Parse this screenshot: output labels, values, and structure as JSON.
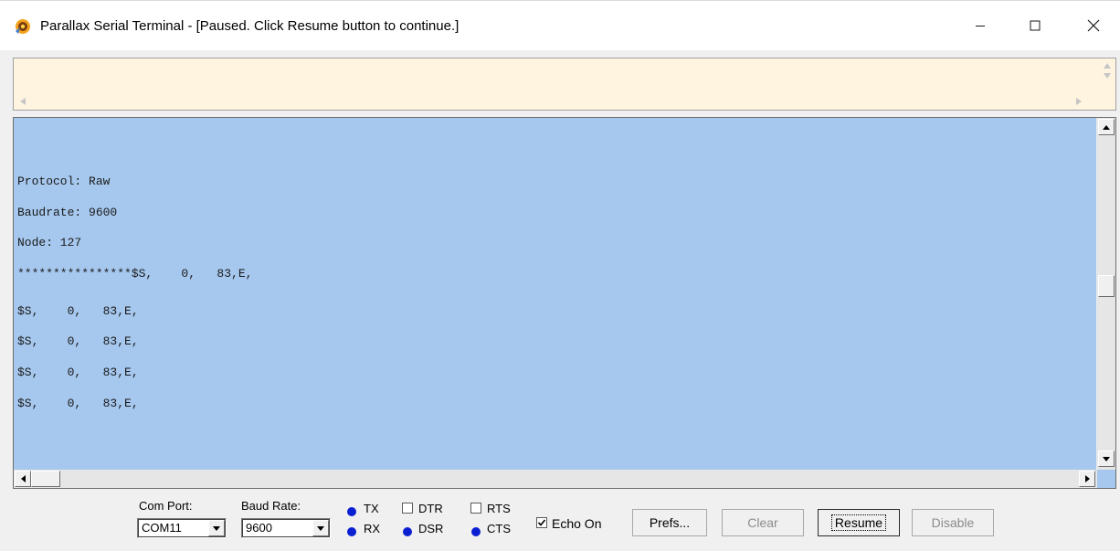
{
  "window": {
    "title": "Parallax Serial Terminal - [Paused.  Click Resume button to continue.]",
    "icon": "parallax-app-icon"
  },
  "colors": {
    "transmit_bg": "#fff4e0",
    "receive_bg": "#a6c8ee",
    "led_on": "#0a1fd1"
  },
  "receive": {
    "lines": [
      "Protocol: Raw",
      "Baudrate: 9600",
      "Node: 127",
      "****************$S,    0,   83,E,",
      "$S,    0,   83,E,",
      "$S,    0,   83,E,",
      "$S,    0,   83,E,",
      "$S,    0,   83,E,"
    ]
  },
  "controls": {
    "com_port_label": "Com Port:",
    "com_port_value": "COM11",
    "baud_rate_label": "Baud Rate:",
    "baud_rate_value": "9600",
    "tx_label": "TX",
    "rx_label": "RX",
    "dtr_label": "DTR",
    "dsr_label": "DSR",
    "rts_label": "RTS",
    "cts_label": "CTS",
    "echo_label": "Echo On",
    "echo_checked": true,
    "prefs_label": "Prefs...",
    "clear_label": "Clear",
    "resume_label": "Resume",
    "disable_label": "Disable"
  }
}
